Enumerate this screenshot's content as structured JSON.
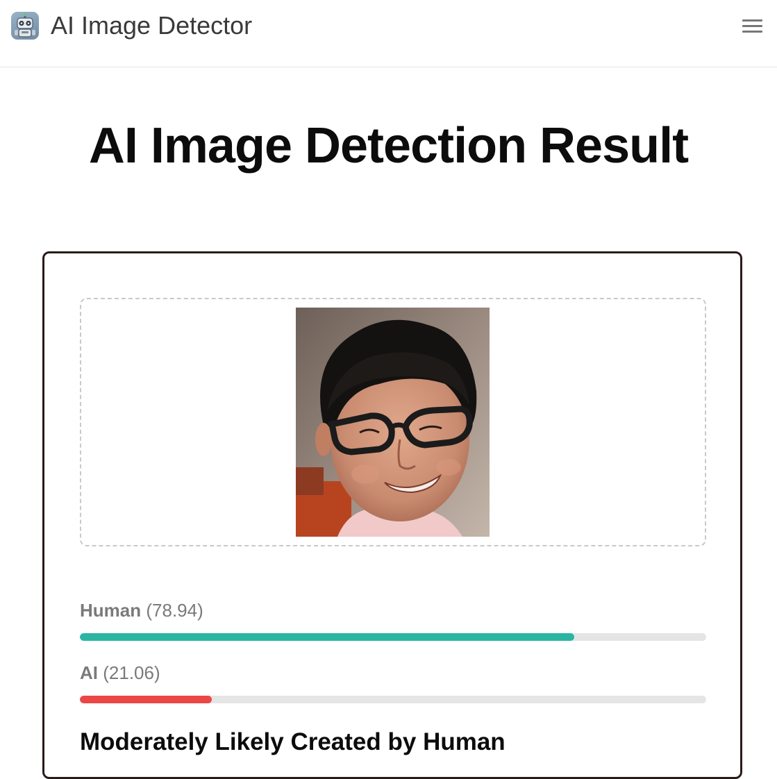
{
  "header": {
    "app_name": "AI Image Detector",
    "logo_icon": "robot-icon",
    "menu_icon": "hamburger-menu-icon"
  },
  "page": {
    "title": "AI Image Detection Result"
  },
  "result": {
    "image_alt": "portrait photo of a smiling man with glasses",
    "scores": [
      {
        "label": "Human",
        "value_text": "(78.94)",
        "value": 78.94,
        "color": "#2bb5a3"
      },
      {
        "label": "AI",
        "value_text": "(21.06)",
        "value": 21.06,
        "color": "#ec4747"
      }
    ],
    "verdict": "Moderately Likely Created by Human"
  }
}
